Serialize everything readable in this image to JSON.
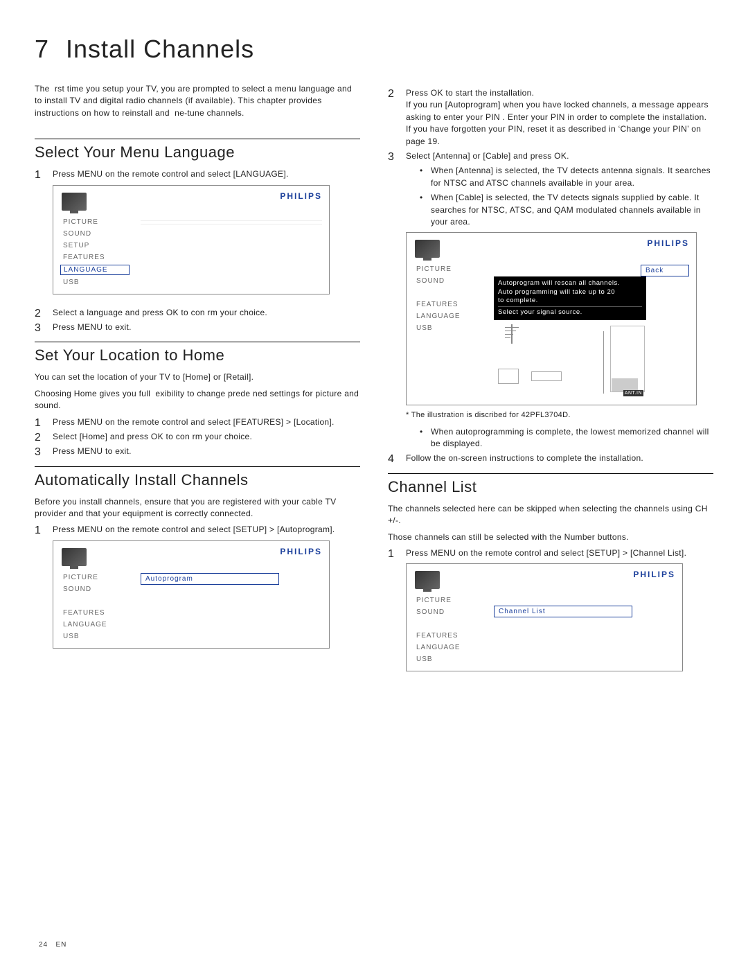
{
  "chapter": {
    "number": "7",
    "title": "Install Channels"
  },
  "intro": "The  rst time you setup your TV, you are prompted to select a menu language and to install TV and digital radio channels (if available). This chapter provides instructions on how to reinstall and  ne-tune channels.",
  "sections": {
    "menuLang": {
      "heading": "Select Your Menu Language",
      "steps": [
        "Press MENU on the remote control and select [LANGUAGE].",
        "Select a language and press OK to con rm your choice.",
        "Press MENU to exit."
      ]
    },
    "location": {
      "heading": "Set Your Location to Home",
      "lead1": "You can set the location of your TV to [Home] or [Retail].",
      "lead2": "Choosing Home gives you full  exibility to change prede ned settings for picture and sound.",
      "steps": [
        "Press MENU on the remote control and select [FEATURES] > [Location].",
        "Select [Home] and press OK to con rm your choice.",
        "Press MENU to exit."
      ]
    },
    "auto": {
      "heading": "Automatically Install Channels",
      "lead": "Before you install channels, ensure that you are registered with your cable TV provider and that your equipment is correctly connected.",
      "step1": "Press MENU on the remote control and select [SETUP] > [Autoprogram]."
    },
    "right": {
      "step2": "Press OK to start the installation.",
      "step2a": "If you run [Autoprogram] when you have locked channels, a message appears asking to enter your PIN . Enter your PIN in order to complete the installation.",
      "step2b": "If you have forgotten your PIN, reset it as described in ‘Change your PIN’ on page 19.",
      "step3": "Select [Antenna] or [Cable] and press OK.",
      "bullets": [
        "When [Antenna] is selected, the TV detects antenna signals. It searches for NTSC and ATSC channels available in your area.",
        "When [Cable] is selected, the TV detects signals supplied by cable. It searches for NTSC, ATSC, and QAM modulated channels available in your area."
      ],
      "footnote": "* The illustration is discribed for 42PFL3704D.",
      "postBullet": "When autoprogramming is complete, the lowest memorized channel will be displayed.",
      "step4": "Follow the on-screen instructions to complete the installation."
    },
    "channelList": {
      "heading": "Channel List",
      "lead1": "The channels selected here can be skipped when selecting the channels using CH +/-.",
      "lead2": "Those channels can still be selected with the Number buttons.",
      "step1": "Press MENU on the remote control and select [SETUP] > [Channel List]."
    }
  },
  "osd": {
    "brand": "PHILIPS",
    "items": [
      "PICTURE",
      "SOUND",
      "SETUP",
      "FEATURES",
      "LANGUAGE",
      "USB"
    ],
    "itemsNoSetup": [
      "PICTURE",
      "SOUND",
      "",
      "FEATURES",
      "LANGUAGE",
      "USB"
    ],
    "autoprogram": "Autoprogram",
    "back": "Back",
    "panelText1": "Autoprogram will rescan all channels.",
    "panelText2": "Auto programming will take up to 20 ",
    "panelText3": "to complete.",
    "panelText4": "Select your signal source.",
    "antIn": "ANT.IN",
    "channelListLabel": "Channel List"
  },
  "footer": {
    "page": "24",
    "lang": "EN"
  }
}
